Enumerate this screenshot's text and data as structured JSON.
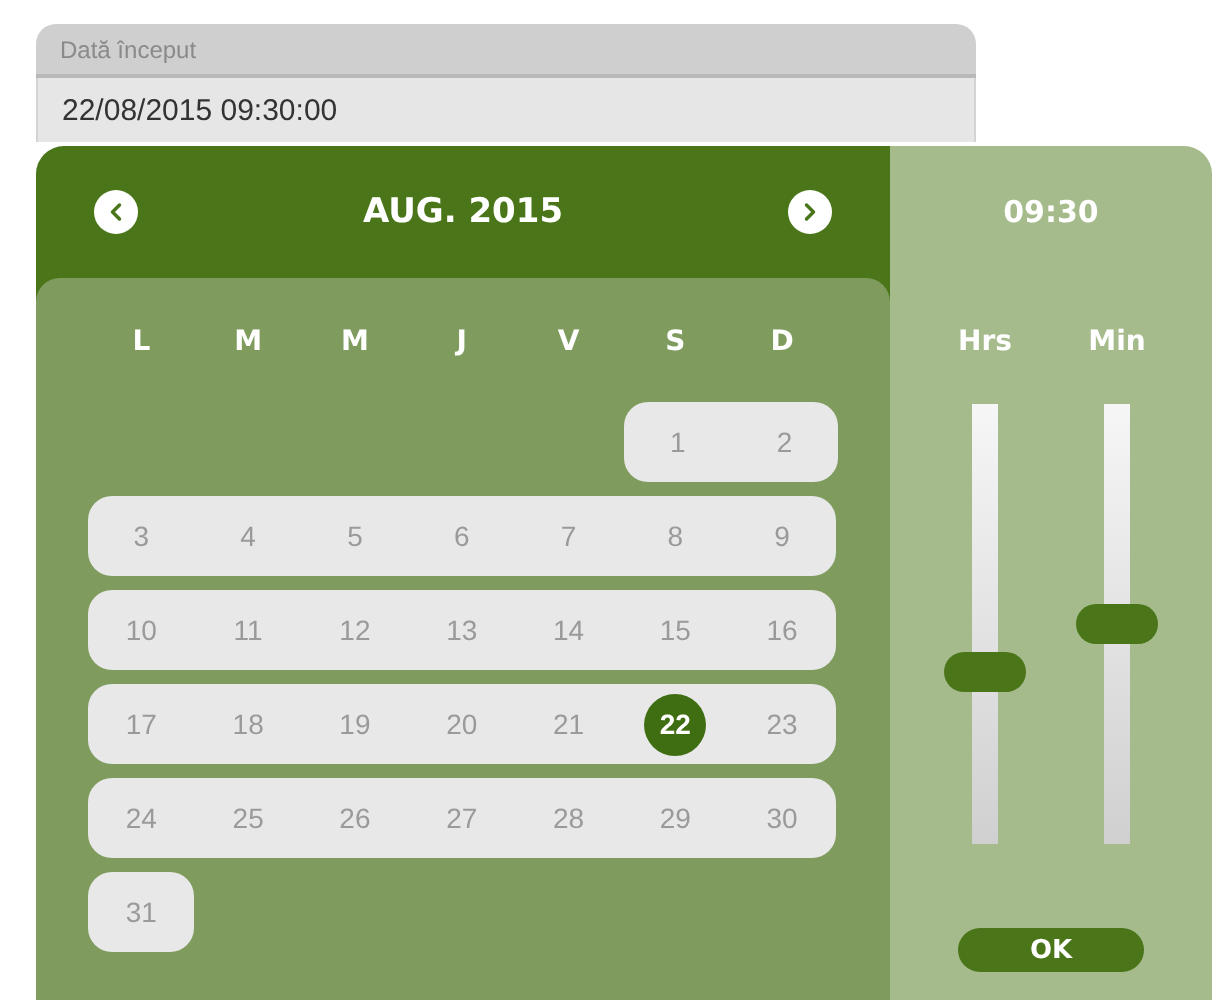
{
  "field": {
    "label": "Dată început",
    "value": "22/08/2015 09:30:00"
  },
  "calendar": {
    "title": "AUG. 2015",
    "weekdays": [
      "L",
      "M",
      "M",
      "J",
      "V",
      "S",
      "D"
    ],
    "weeks": [
      [
        {
          "day": "1",
          "selected": false
        },
        {
          "day": "2",
          "selected": false
        }
      ],
      [
        {
          "day": "3",
          "selected": false
        },
        {
          "day": "4",
          "selected": false
        },
        {
          "day": "5",
          "selected": false
        },
        {
          "day": "6",
          "selected": false
        },
        {
          "day": "7",
          "selected": false
        },
        {
          "day": "8",
          "selected": false
        },
        {
          "day": "9",
          "selected": false
        }
      ],
      [
        {
          "day": "10",
          "selected": false
        },
        {
          "day": "11",
          "selected": false
        },
        {
          "day": "12",
          "selected": false
        },
        {
          "day": "13",
          "selected": false
        },
        {
          "day": "14",
          "selected": false
        },
        {
          "day": "15",
          "selected": false
        },
        {
          "day": "16",
          "selected": false
        }
      ],
      [
        {
          "day": "17",
          "selected": false
        },
        {
          "day": "18",
          "selected": false
        },
        {
          "day": "19",
          "selected": false
        },
        {
          "day": "20",
          "selected": false
        },
        {
          "day": "21",
          "selected": false
        },
        {
          "day": "22",
          "selected": true
        },
        {
          "day": "23",
          "selected": false
        }
      ],
      [
        {
          "day": "24",
          "selected": false
        },
        {
          "day": "25",
          "selected": false
        },
        {
          "day": "26",
          "selected": false
        },
        {
          "day": "27",
          "selected": false
        },
        {
          "day": "28",
          "selected": false
        },
        {
          "day": "29",
          "selected": false
        },
        {
          "day": "30",
          "selected": false
        }
      ],
      [
        {
          "day": "31",
          "selected": false
        }
      ]
    ]
  },
  "time": {
    "value": "09:30",
    "sliders": [
      {
        "label": "Hrs",
        "level": 0.39
      },
      {
        "label": "Min",
        "level": 0.5
      }
    ],
    "button": "OK"
  }
}
